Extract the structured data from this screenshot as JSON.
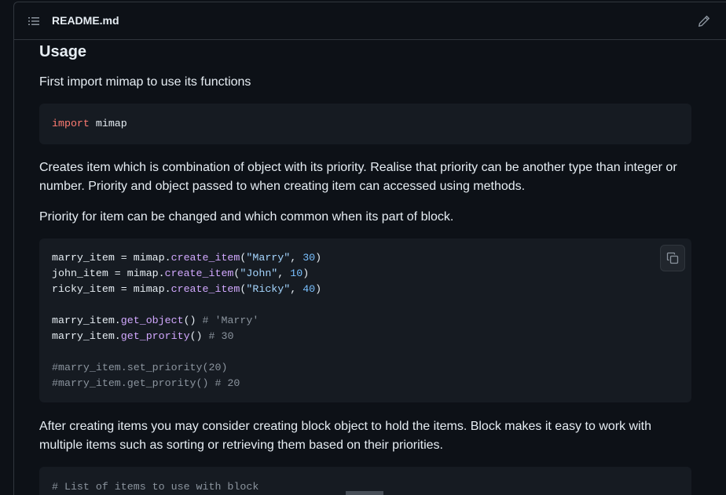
{
  "header": {
    "filename": "README.md"
  },
  "icons": {
    "toc": "list-unordered-icon",
    "edit": "pencil-icon",
    "copy": "copy-icon"
  },
  "content": {
    "heading": "Usage",
    "para1": "First import mimap to use its functions",
    "code1": {
      "keyword": "import",
      "module": " mimap"
    },
    "para2": "Creates item which is combination of object with its priority. Realise that priority can be another type than integer or number. Priority and object passed to when creating item can accessed using methods.",
    "para3": "Priority for item can be changed and which common when its part of block.",
    "code2": {
      "lines": [
        {
          "a": "marry_item = mimap.",
          "fn": "create_item",
          "b": "(",
          "s": "\"Marry\"",
          "c": ", ",
          "n": "30",
          "d": ")"
        },
        {
          "a": "john_item = mimap.",
          "fn": "create_item",
          "b": "(",
          "s": "\"John\"",
          "c": ", ",
          "n": "10",
          "d": ")"
        },
        {
          "a": "ricky_item = mimap.",
          "fn": "create_item",
          "b": "(",
          "s": "\"Ricky\"",
          "c": ", ",
          "n": "40",
          "d": ")"
        }
      ],
      "getter1": {
        "a": "marry_item.",
        "fn": "get_object",
        "b": "() ",
        "cm": "# 'Marry'"
      },
      "getter2": {
        "a": "marry_item.",
        "fn": "get_prority",
        "b": "() ",
        "cm": "# 30"
      },
      "comment1": "#marry_item.set_priority(20)",
      "comment2": "#marry_item.get_prority() # 20"
    },
    "para4": "After creating items you may consider creating block object to hold the items. Block makes it easy to work with multiple items such as sorting or retrieving them based on their priorities.",
    "code3": {
      "comment": "# List of items to use with block"
    }
  }
}
